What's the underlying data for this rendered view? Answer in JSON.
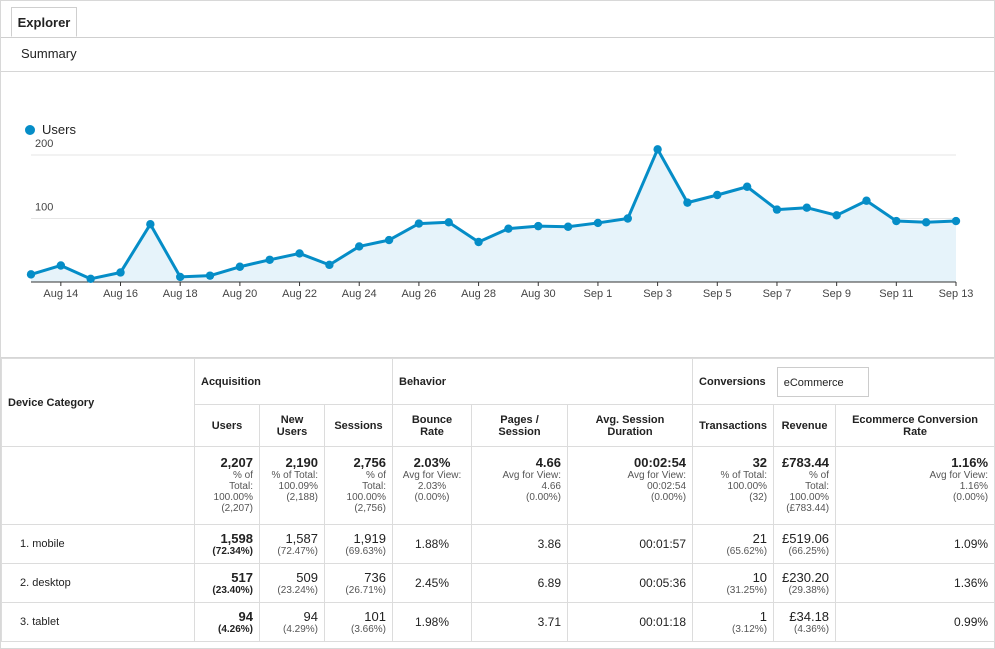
{
  "tabs": {
    "explorer": "Explorer"
  },
  "subnav": {
    "summary": "Summary"
  },
  "chart_data": {
    "type": "area",
    "series": [
      {
        "name": "Users",
        "values": [
          12,
          26,
          5,
          15,
          91,
          8,
          10,
          24,
          35,
          45,
          27,
          56,
          66,
          92,
          94,
          63,
          84,
          88,
          87,
          93,
          100,
          209,
          125,
          137,
          150,
          114,
          117,
          105,
          128,
          96,
          94,
          96
        ]
      }
    ],
    "legend": "Users",
    "yticks": [
      "200",
      "100"
    ],
    "ylim": [
      0,
      220
    ],
    "xticks": [
      "Aug 14",
      "Aug 16",
      "Aug 18",
      "Aug 20",
      "Aug 22",
      "Aug 24",
      "Aug 26",
      "Aug 28",
      "Aug 30",
      "Sep 1",
      "Sep 3",
      "Sep 5",
      "Sep 7",
      "Sep 9",
      "Sep 11",
      "Sep 13"
    ],
    "grid": true,
    "color": "#058dc7"
  },
  "table": {
    "device_category": "Device Category",
    "groups": {
      "acquisition": "Acquisition",
      "behavior": "Behavior",
      "conversions": "Conversions",
      "ecommerce_select": "eCommerce"
    },
    "columns": {
      "users": "Users",
      "new_users": "New Users",
      "sessions": "Sessions",
      "bounce_rate": "Bounce Rate",
      "pages_session": "Pages / Session",
      "avg_session": "Avg. Session Duration",
      "transactions": "Transactions",
      "revenue": "Revenue",
      "ecr": "Ecommerce Conversion Rate"
    },
    "totals": {
      "users": {
        "value": "2,207",
        "l1": "% of",
        "l2": "Total:",
        "l3": "100.00%",
        "l4": "(2,207)"
      },
      "new_users": {
        "value": "2,190",
        "l1": "% of Total:",
        "l2": "100.09%",
        "l3": "(2,188)"
      },
      "sessions": {
        "value": "2,756",
        "l1": "% of",
        "l2": "Total:",
        "l3": "100.00%",
        "l4": "(2,756)"
      },
      "bounce_rate": {
        "value": "2.03%",
        "l1": "Avg for View:",
        "l2": "2.03%",
        "l3": "(0.00%)"
      },
      "pages_session": {
        "value": "4.66",
        "l1": "Avg for View:",
        "l2": "4.66",
        "l3": "(0.00%)"
      },
      "avg_session": {
        "value": "00:02:54",
        "l1": "Avg for View:",
        "l2": "00:02:54",
        "l3": "(0.00%)"
      },
      "transactions": {
        "value": "32",
        "l1": "% of Total:",
        "l2": "100.00%",
        "l3": "(32)"
      },
      "revenue": {
        "value": "£783.44",
        "l1": "% of",
        "l2": "Total:",
        "l3": "100.00%",
        "l4": "(£783.44)"
      },
      "ecr": {
        "value": "1.16%",
        "l1": "Avg for View:",
        "l2": "1.16%",
        "l3": "(0.00%)"
      }
    },
    "rows": [
      {
        "label": "1.  mobile",
        "users": "1,598",
        "users_pct": "(72.34%)",
        "new_users": "1,587",
        "new_users_pct": "(72.47%)",
        "sessions": "1,919",
        "sessions_pct": "(69.63%)",
        "bounce": "1.88%",
        "pages": "3.86",
        "duration": "00:01:57",
        "transactions": "21",
        "transactions_pct": "(65.62%)",
        "revenue": "£519.06",
        "revenue_pct": "(66.25%)",
        "ecr": "1.09%"
      },
      {
        "label": "2.  desktop",
        "users": "517",
        "users_pct": "(23.40%)",
        "new_users": "509",
        "new_users_pct": "(23.24%)",
        "sessions": "736",
        "sessions_pct": "(26.71%)",
        "bounce": "2.45%",
        "pages": "6.89",
        "duration": "00:05:36",
        "transactions": "10",
        "transactions_pct": "(31.25%)",
        "revenue": "£230.20",
        "revenue_pct": "(29.38%)",
        "ecr": "1.36%"
      },
      {
        "label": "3.  tablet",
        "users": "94",
        "users_pct": "(4.26%)",
        "new_users": "94",
        "new_users_pct": "(4.29%)",
        "sessions": "101",
        "sessions_pct": "(3.66%)",
        "bounce": "1.98%",
        "pages": "3.71",
        "duration": "00:01:18",
        "transactions": "1",
        "transactions_pct": "(3.12%)",
        "revenue": "£34.18",
        "revenue_pct": "(4.36%)",
        "ecr": "0.99%"
      }
    ]
  }
}
